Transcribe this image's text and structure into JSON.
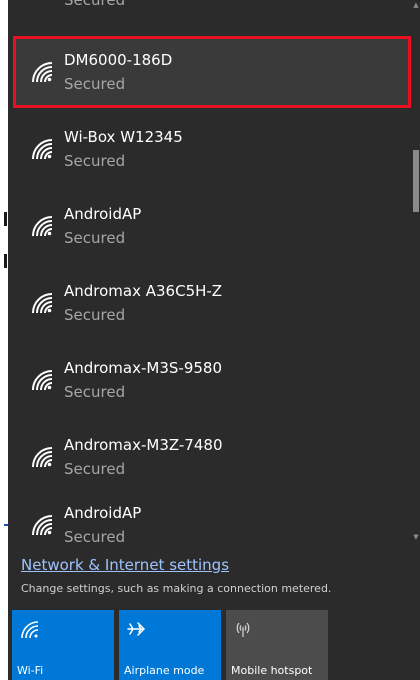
{
  "partial_above": {
    "status": "Secured"
  },
  "networks": [
    {
      "name": "DM6000-186D",
      "status": "Secured"
    },
    {
      "name": "Wi-Box W12345",
      "status": "Secured"
    },
    {
      "name": "AndroidAP",
      "status": "Secured"
    },
    {
      "name": "Andromax A36C5H-Z",
      "status": "Secured"
    },
    {
      "name": "Andromax-M3S-9580",
      "status": "Secured"
    },
    {
      "name": "Andromax-M3Z-7480",
      "status": "Secured"
    },
    {
      "name": "AndroidAP",
      "status": "Secured"
    }
  ],
  "selected_network_index": 0,
  "settings": {
    "link": "Network & Internet settings",
    "subtitle": "Change settings, such as making a connection metered."
  },
  "quick_actions": [
    {
      "label": "Wi-Fi",
      "icon": "wifi-icon",
      "state": "on"
    },
    {
      "label": "Airplane mode",
      "icon": "airplane-icon",
      "state": "on"
    },
    {
      "label": "Mobile hotspot",
      "icon": "hotspot-icon",
      "state": "off"
    }
  ],
  "colors": {
    "flyout_bg": "#2b2b2b",
    "selection_border": "#e81123",
    "accent": "#0078d7",
    "link": "#9ec3ff"
  }
}
